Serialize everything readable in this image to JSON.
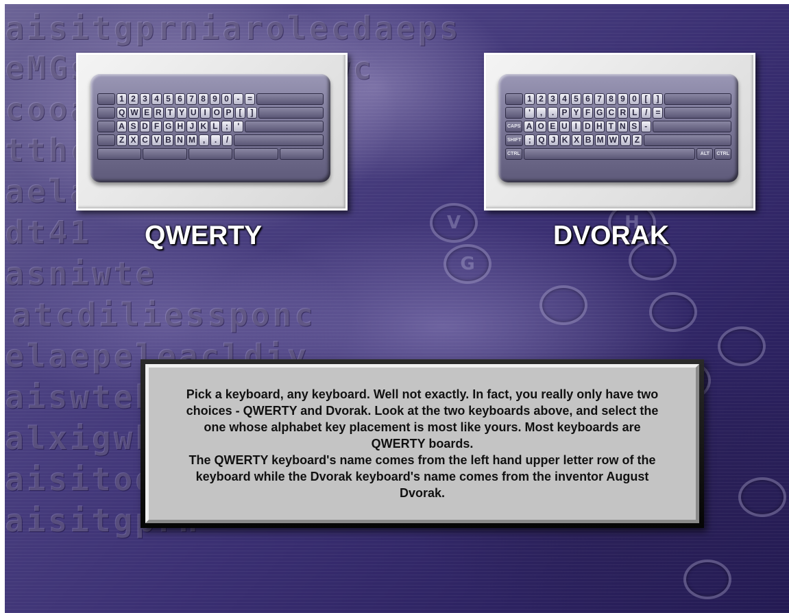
{
  "background": {
    "letter_rows": [
      "aisitgprniarolecdaeps",
      "eMGsinbelsdzsdswc",
      "cooa",
      "tthc",
      "aela",
      "dt41",
      "asniwte",
      "atcdiliessponc",
      "elaepeleacldiy",
      "aiswtebeleroc",
      "alxigwheeleqd",
      "aisitodfhrdnd",
      "aisitgprn"
    ],
    "circle_letters": [
      "V",
      "H",
      "G",
      "",
      "",
      "",
      "",
      "",
      "",
      ""
    ]
  },
  "qwerty": {
    "label": "QWERTY",
    "rows": [
      [
        "",
        "1",
        "2",
        "3",
        "4",
        "5",
        "6",
        "7",
        "8",
        "9",
        "0",
        "-",
        "=",
        ""
      ],
      [
        "",
        "Q",
        "W",
        "E",
        "R",
        "T",
        "Y",
        "U",
        "I",
        "O",
        "P",
        "[",
        "]",
        ""
      ],
      [
        "",
        "A",
        "S",
        "D",
        "F",
        "G",
        "H",
        "J",
        "K",
        "L",
        ";",
        "'",
        ""
      ],
      [
        "",
        "Z",
        "X",
        "C",
        "V",
        "B",
        "N",
        "M",
        ",",
        ".",
        "/",
        ""
      ],
      [
        "",
        "",
        "",
        "",
        ""
      ]
    ]
  },
  "dvorak": {
    "label": "DVORAK",
    "rows": [
      [
        "",
        "1",
        "2",
        "3",
        "4",
        "5",
        "6",
        "7",
        "8",
        "9",
        "0",
        "[",
        "]",
        ""
      ],
      [
        "",
        "'",
        ",",
        ".",
        "P",
        "Y",
        "F",
        "G",
        "C",
        "R",
        "L",
        "/",
        "=",
        ""
      ],
      [
        "CAPS",
        "A",
        "O",
        "E",
        "U",
        "I",
        "D",
        "H",
        "T",
        "N",
        "S",
        "-",
        ""
      ],
      [
        "SHIFT",
        ";",
        "Q",
        "J",
        "K",
        "X",
        "B",
        "M",
        "W",
        "V",
        "Z",
        "SHIFT"
      ],
      [
        "CTRL",
        "",
        "ALT",
        "CTRL"
      ]
    ]
  },
  "info": {
    "text": "Pick a keyboard, any keyboard.  Well not exactly.  In fact, you really only have two choices - QWERTY and Dvorak.  Look at the two keyboards above, and select the one whose alphabet key placement is most like yours.  Most keyboards are QWERTY boards.\nThe QWERTY keyboard's name comes from the left hand upper letter row of the keyboard while the Dvorak keyboard's name comes from the inventor August Dvorak."
  }
}
